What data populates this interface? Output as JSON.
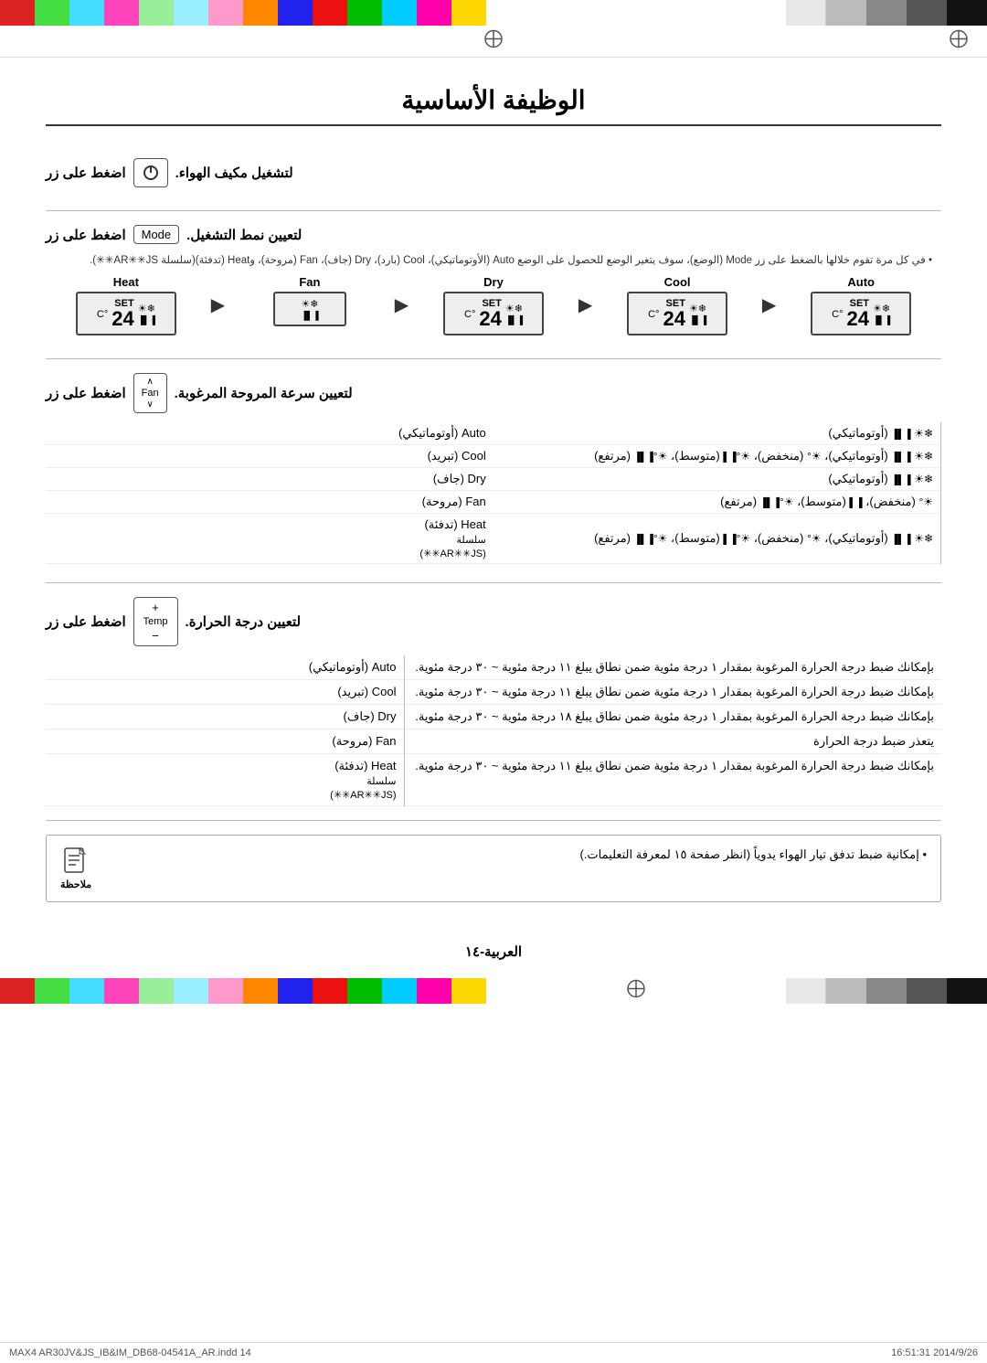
{
  "page": {
    "title": "الوظيفة الأساسية",
    "page_number": "العربية-١٤",
    "footer_left": "MAX4 AR30JV&JS_IB&IM_DB68-04541A_AR.indd  14",
    "footer_right": "2014/9/26  16:51:31"
  },
  "top_strips": {
    "left_swatches": [
      "black",
      "darkgray",
      "gray",
      "lightgray",
      "white"
    ],
    "right_swatches": [
      "yellow",
      "magenta",
      "cyan",
      "green",
      "red",
      "blue",
      "orange",
      "pink",
      "ltcyan",
      "ltgreen",
      "magenta2",
      "cyan2",
      "green2",
      "red2"
    ]
  },
  "section1": {
    "instruction": "اضغط على زر",
    "btn_label": "",
    "suffix": "لتشغيل مكيف الهواء.",
    "has_power_icon": true
  },
  "section2": {
    "instruction": "اضغط على زر",
    "btn_label": "Mode",
    "suffix": "لتعيين نمط التشغيل.",
    "note": "في كل مرة تقوم خلالها بالضغط على زر Mode (الوضع)، سوف يتغير الوضع للحصول على الوضع Auto (الأوتوماتيكي)، Cool (بارد)، Dry (جاف)، Fan (مروحة)، وHeat (تدفئة)(سلسلة AR✳✳JS✳✳).",
    "modes": [
      {
        "label": "Auto",
        "temp": "24",
        "has_set": true,
        "has_fan": true,
        "has_bars": true,
        "has_leaf": true
      },
      {
        "label": "Cool",
        "temp": "24",
        "has_set": true,
        "has_fan": true,
        "has_bars": true,
        "has_leaf": true
      },
      {
        "label": "Dry",
        "temp": "24",
        "has_set": true,
        "has_fan": true,
        "has_bars": true,
        "has_leaf": true
      },
      {
        "label": "Fan",
        "temp": "",
        "has_set": false,
        "has_fan": true,
        "has_bars": true,
        "has_leaf": false
      },
      {
        "label": "Heat",
        "temp": "24",
        "has_set": true,
        "has_fan": true,
        "has_bars": true,
        "has_leaf": true
      }
    ]
  },
  "section3": {
    "instruction": "اضغط على زر",
    "btn_label": "Fan",
    "btn_arrows": [
      "∧",
      "∨"
    ],
    "suffix": "لتعيين سرعة المروحة المرغوبة.",
    "rows": [
      {
        "mode": "Auto (أوتوماتيكي)",
        "speeds": "☀❄ ▐▐▐ (أوتوماتيكي)"
      },
      {
        "mode": "Cool (تبريد)",
        "speeds": "☀❄ ▐▐▐ (أوتوماتيكي)، ☀ᵒ (منخفض)، ☀ᵒ▐▐ (متوسط)، ☀ᵒ▐▐▐ (مرتفع)"
      },
      {
        "mode": "Dry (جاف)",
        "speeds": "☀❄ ▐▐▐ (أوتوماتيكي)"
      },
      {
        "mode": "Fan (مروحة)",
        "speeds": "☀ᵒ (منخفض)، ▐▐ (متوسط)، ☀ᵒ▐▐▐ (مرتفع)"
      },
      {
        "mode": "Heat (تدفئة) سلسلة (AR✳✳JS✳✳)",
        "speeds": "☀❄ ▐▐▐ (أوتوماتيكي)، ☀ᵒ (منخفض)، ☀ᵒ▐▐ (متوسط)، ☀ᵒ▐▐▐ (مرتفع)"
      }
    ]
  },
  "section4": {
    "instruction": "اضغط على زر",
    "btn_label": "Temp",
    "btn_plus": "+",
    "btn_minus": "−",
    "suffix": "لتعيين درجة الحرارة.",
    "rows": [
      {
        "mode": "Auto (أوتوماتيكي)",
        "desc": "بإمكانك ضبط درجة الحرارة المرغوبة بمقدار ١ درجة مئوية ضمن نطاق يبلغ ١١ درجة مئوية ~ ٣٠ درجة مئوية."
      },
      {
        "mode": "Cool (تبريد)",
        "desc": "بإمكانك ضبط درجة الحرارة المرغوبة بمقدار ١ درجة مئوية ضمن نطاق يبلغ ١١ درجة مئوية ~ ٣٠ درجة مئوية."
      },
      {
        "mode": "Dry (جاف)",
        "desc": "بإمكانك ضبط درجة الحرارة المرغوبة بمقدار ١ درجة مئوية ضمن نطاق يبلغ ١٨ درجة مئوية ~ ٣٠ درجة مئوية."
      },
      {
        "mode": "Fan (مروحة)",
        "desc": "يتعذر ضبط درجة الحرارة"
      },
      {
        "mode": "Heat (تدفئة) سلسلة (AR✳✳JS✳✳)",
        "desc": "بإمكانك ضبط درجة الحرارة المرغوبة بمقدار ١ درجة مئوية ضمن نطاق يبلغ ١١ درجة مئوية ~ ٣٠ درجة مئوية."
      }
    ]
  },
  "note": {
    "text": "إمكانية ضبط تدفق تيار الهواء يدوياً (انظر صفحة ١٥ لمعرفة التعليمات.)"
  },
  "labels": {
    "set": "SET",
    "celsius": "°C",
    "note_label": "ملاحظة"
  }
}
